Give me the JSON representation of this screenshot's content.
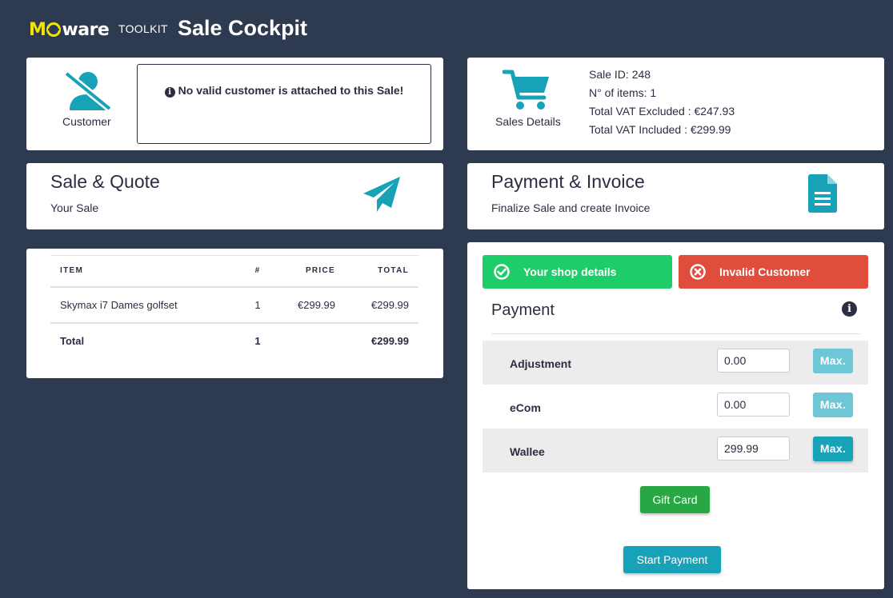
{
  "header": {
    "logo_part1": "M",
    "logo_part2": "ware",
    "toolkit_label": "TOOLKIT",
    "title": "Sale Cockpit"
  },
  "customer": {
    "label": "Customer",
    "alert": "No valid customer is attached to this Sale!"
  },
  "sales_details": {
    "label": "Sales Details",
    "sale_id": "Sale ID: 248",
    "items_count": "N° of items: 1",
    "vat_excluded": "Total VAT Excluded : €247.93",
    "vat_included": "Total VAT Included : €299.99"
  },
  "sale_quote": {
    "title": "Sale & Quote",
    "subtitle": "Your Sale"
  },
  "payment_invoice": {
    "title": "Payment & Invoice",
    "subtitle": "Finalize Sale and create Invoice"
  },
  "items_table": {
    "headers": [
      "ITEM",
      "#",
      "PRICE",
      "TOTAL"
    ],
    "rows": [
      {
        "item": "Skymax i7 Dames golfset",
        "qty": "1",
        "price": "€299.99",
        "total": "€299.99"
      }
    ],
    "footer": {
      "label": "Total",
      "qty": "1",
      "total": "€299.99"
    }
  },
  "payment": {
    "shop_details_label": "Your shop details",
    "invalid_customer_label": "Invalid Customer",
    "title": "Payment",
    "rows": [
      {
        "label": "Adjustment",
        "value": "0.00",
        "max_label": "Max."
      },
      {
        "label": "eCom",
        "value": "0.00",
        "max_label": "Max."
      },
      {
        "label": "Wallee",
        "value": "299.99",
        "max_label": "Max."
      }
    ],
    "gift_card_label": "Gift Card",
    "start_payment_label": "Start Payment"
  },
  "colors": {
    "background": "#2d3a50",
    "accent": "#17a2b8",
    "success": "#1fcc6a",
    "danger": "#e04d3d",
    "gift": "#28a745",
    "logo_yellow": "#f5e400"
  }
}
